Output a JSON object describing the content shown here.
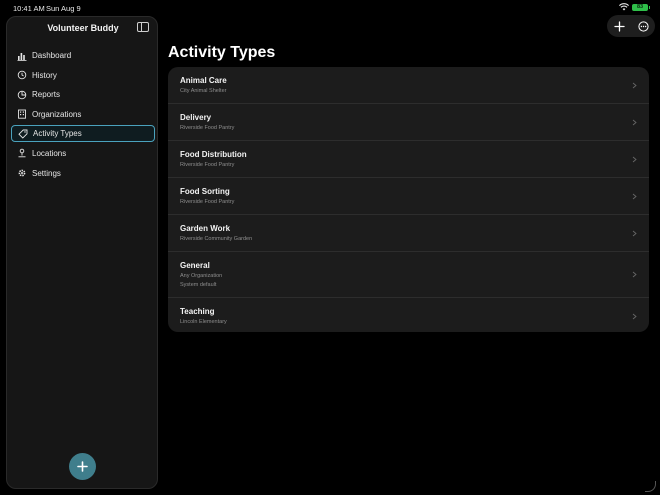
{
  "status": {
    "time": "10:41 AM",
    "date": "Sun Aug 9",
    "battery": "83"
  },
  "sidebar": {
    "title": "Volunteer Buddy",
    "items": [
      {
        "label": "Dashboard",
        "icon": "chart-bar-icon"
      },
      {
        "label": "History",
        "icon": "clock-history-icon"
      },
      {
        "label": "Reports",
        "icon": "pie-chart-icon"
      },
      {
        "label": "Organizations",
        "icon": "building-icon"
      },
      {
        "label": "Activity Types",
        "icon": "tag-icon",
        "active": true
      },
      {
        "label": "Locations",
        "icon": "map-pin-icon"
      },
      {
        "label": "Settings",
        "icon": "gear-icon"
      }
    ]
  },
  "main": {
    "title": "Activity Types",
    "rows": [
      {
        "title": "Animal Care",
        "lines": [
          "City Animal Shelter"
        ]
      },
      {
        "title": "Delivery",
        "lines": [
          "Riverside Food Pantry"
        ]
      },
      {
        "title": "Food Distribution",
        "lines": [
          "Riverside Food Pantry"
        ]
      },
      {
        "title": "Food Sorting",
        "lines": [
          "Riverside Food Pantry"
        ]
      },
      {
        "title": "Garden Work",
        "lines": [
          "Riverside Community Garden"
        ]
      },
      {
        "title": "General",
        "lines": [
          "Any Organization",
          "System default"
        ]
      },
      {
        "title": "Teaching",
        "lines": [
          "Lincoln Elementary"
        ]
      }
    ]
  },
  "colors": {
    "accent": "#4aa2bd",
    "fab": "#3f7e8c",
    "battery": "#2fbf4a"
  }
}
